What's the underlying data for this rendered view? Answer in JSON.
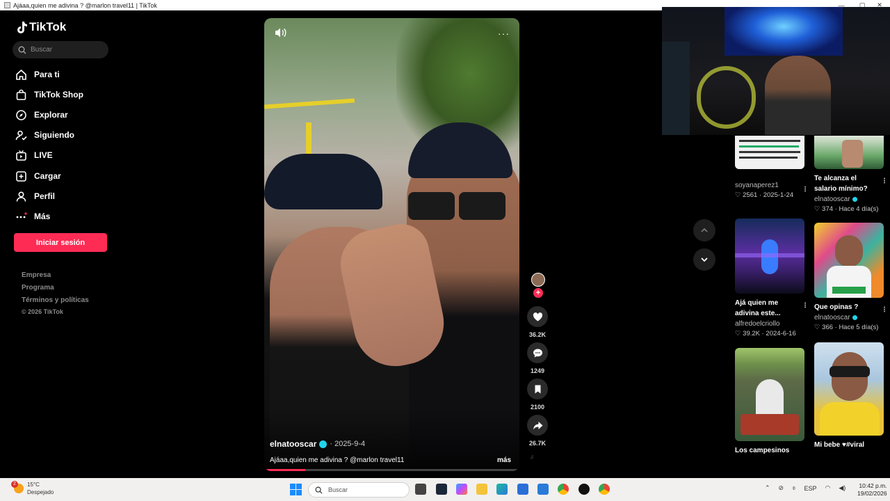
{
  "window": {
    "title": "Ajáaa,quien me adivina ? @marlon travel11 | TikTok",
    "min": "—",
    "max": "▢",
    "close": "✕"
  },
  "sidebar": {
    "logo": "TikTok",
    "search_placeholder": "Buscar",
    "nav": [
      {
        "label": "Para ti",
        "icon": "home-icon"
      },
      {
        "label": "TikTok Shop",
        "icon": "shop-bag-icon"
      },
      {
        "label": "Explorar",
        "icon": "compass-icon"
      },
      {
        "label": "Siguiendo",
        "icon": "following-icon"
      },
      {
        "label": "LIVE",
        "icon": "live-tv-icon"
      },
      {
        "label": "Cargar",
        "icon": "upload-plus-icon"
      },
      {
        "label": "Perfil",
        "icon": "profile-icon"
      },
      {
        "label": "Más",
        "icon": "more-dots-icon"
      }
    ],
    "login_button": "Iniciar sesión",
    "footer_links": [
      "Empresa",
      "Programa",
      "Términos y políticas"
    ],
    "copyright": "© 2026 TikTok"
  },
  "video": {
    "author": "elnatooscar",
    "date": "· 2025-9-4",
    "caption": "Ajáaa,quien me adivina ? @marlon travel11",
    "more": "más",
    "progress": 0.16,
    "actions": {
      "likes": "36.2K",
      "comments": "1249",
      "saves": "2100",
      "shares": "26.7K"
    }
  },
  "recommended": [
    {
      "title": "",
      "author": "soyanaperez1",
      "meta": "♡ 2561 · 2025-1-24",
      "verified": false,
      "thumb_color": "#f1f1f1"
    },
    {
      "title": "Te alcanza el salario mínimo?",
      "author": "elnatooscar",
      "meta": "♡ 374 · Hace 4 día(s)",
      "verified": true,
      "thumb_color": "#2f5c35"
    },
    {
      "title": "Ajá quien me adivina este...",
      "author": "alfredoelcriollo",
      "meta": "♡ 39.2K · 2024-6-16",
      "verified": false,
      "thumb_color": "#3a2a7a"
    },
    {
      "title": "Que opinas ?",
      "author": "elnatooscar",
      "meta": "♡ 366 · Hace 5 día(s)",
      "verified": true,
      "thumb_color": "#c24a74"
    },
    {
      "title": "Los campesinos",
      "author": "",
      "meta": "",
      "verified": false,
      "thumb_color": "#4c6b3a"
    },
    {
      "title": "Mi bebe ♥#viral",
      "author": "",
      "meta": "",
      "verified": false,
      "thumb_color": "#7aa0c8"
    }
  ],
  "taskbar": {
    "weather_temp": "15°C",
    "weather_desc": "Despejado",
    "weather_badge": "2",
    "search_placeholder": "Buscar",
    "lang": "ESP",
    "time": "10:42 p.m.",
    "date": "19/02/2026"
  }
}
